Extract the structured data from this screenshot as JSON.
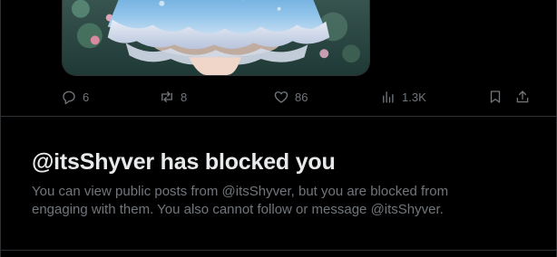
{
  "tweet": {
    "actions": {
      "reply": {
        "icon": "reply-icon",
        "count": "6"
      },
      "repost": {
        "icon": "repost-icon",
        "count": "8"
      },
      "like": {
        "icon": "heart-icon",
        "count": "86"
      },
      "views": {
        "icon": "views-icon",
        "count": "1.3K"
      },
      "bookmark": {
        "icon": "bookmark-icon"
      },
      "share": {
        "icon": "share-icon"
      }
    }
  },
  "blocked_notice": {
    "title": "@itsShyver has blocked you",
    "message": "You can view public posts from @itsShyver, but you are blocked from engaging with them. You also cannot follow or message @itsShyver."
  },
  "colors": {
    "background": "#000000",
    "text_primary": "#e7e9ea",
    "text_secondary": "#71767b",
    "border": "#2f3336"
  }
}
